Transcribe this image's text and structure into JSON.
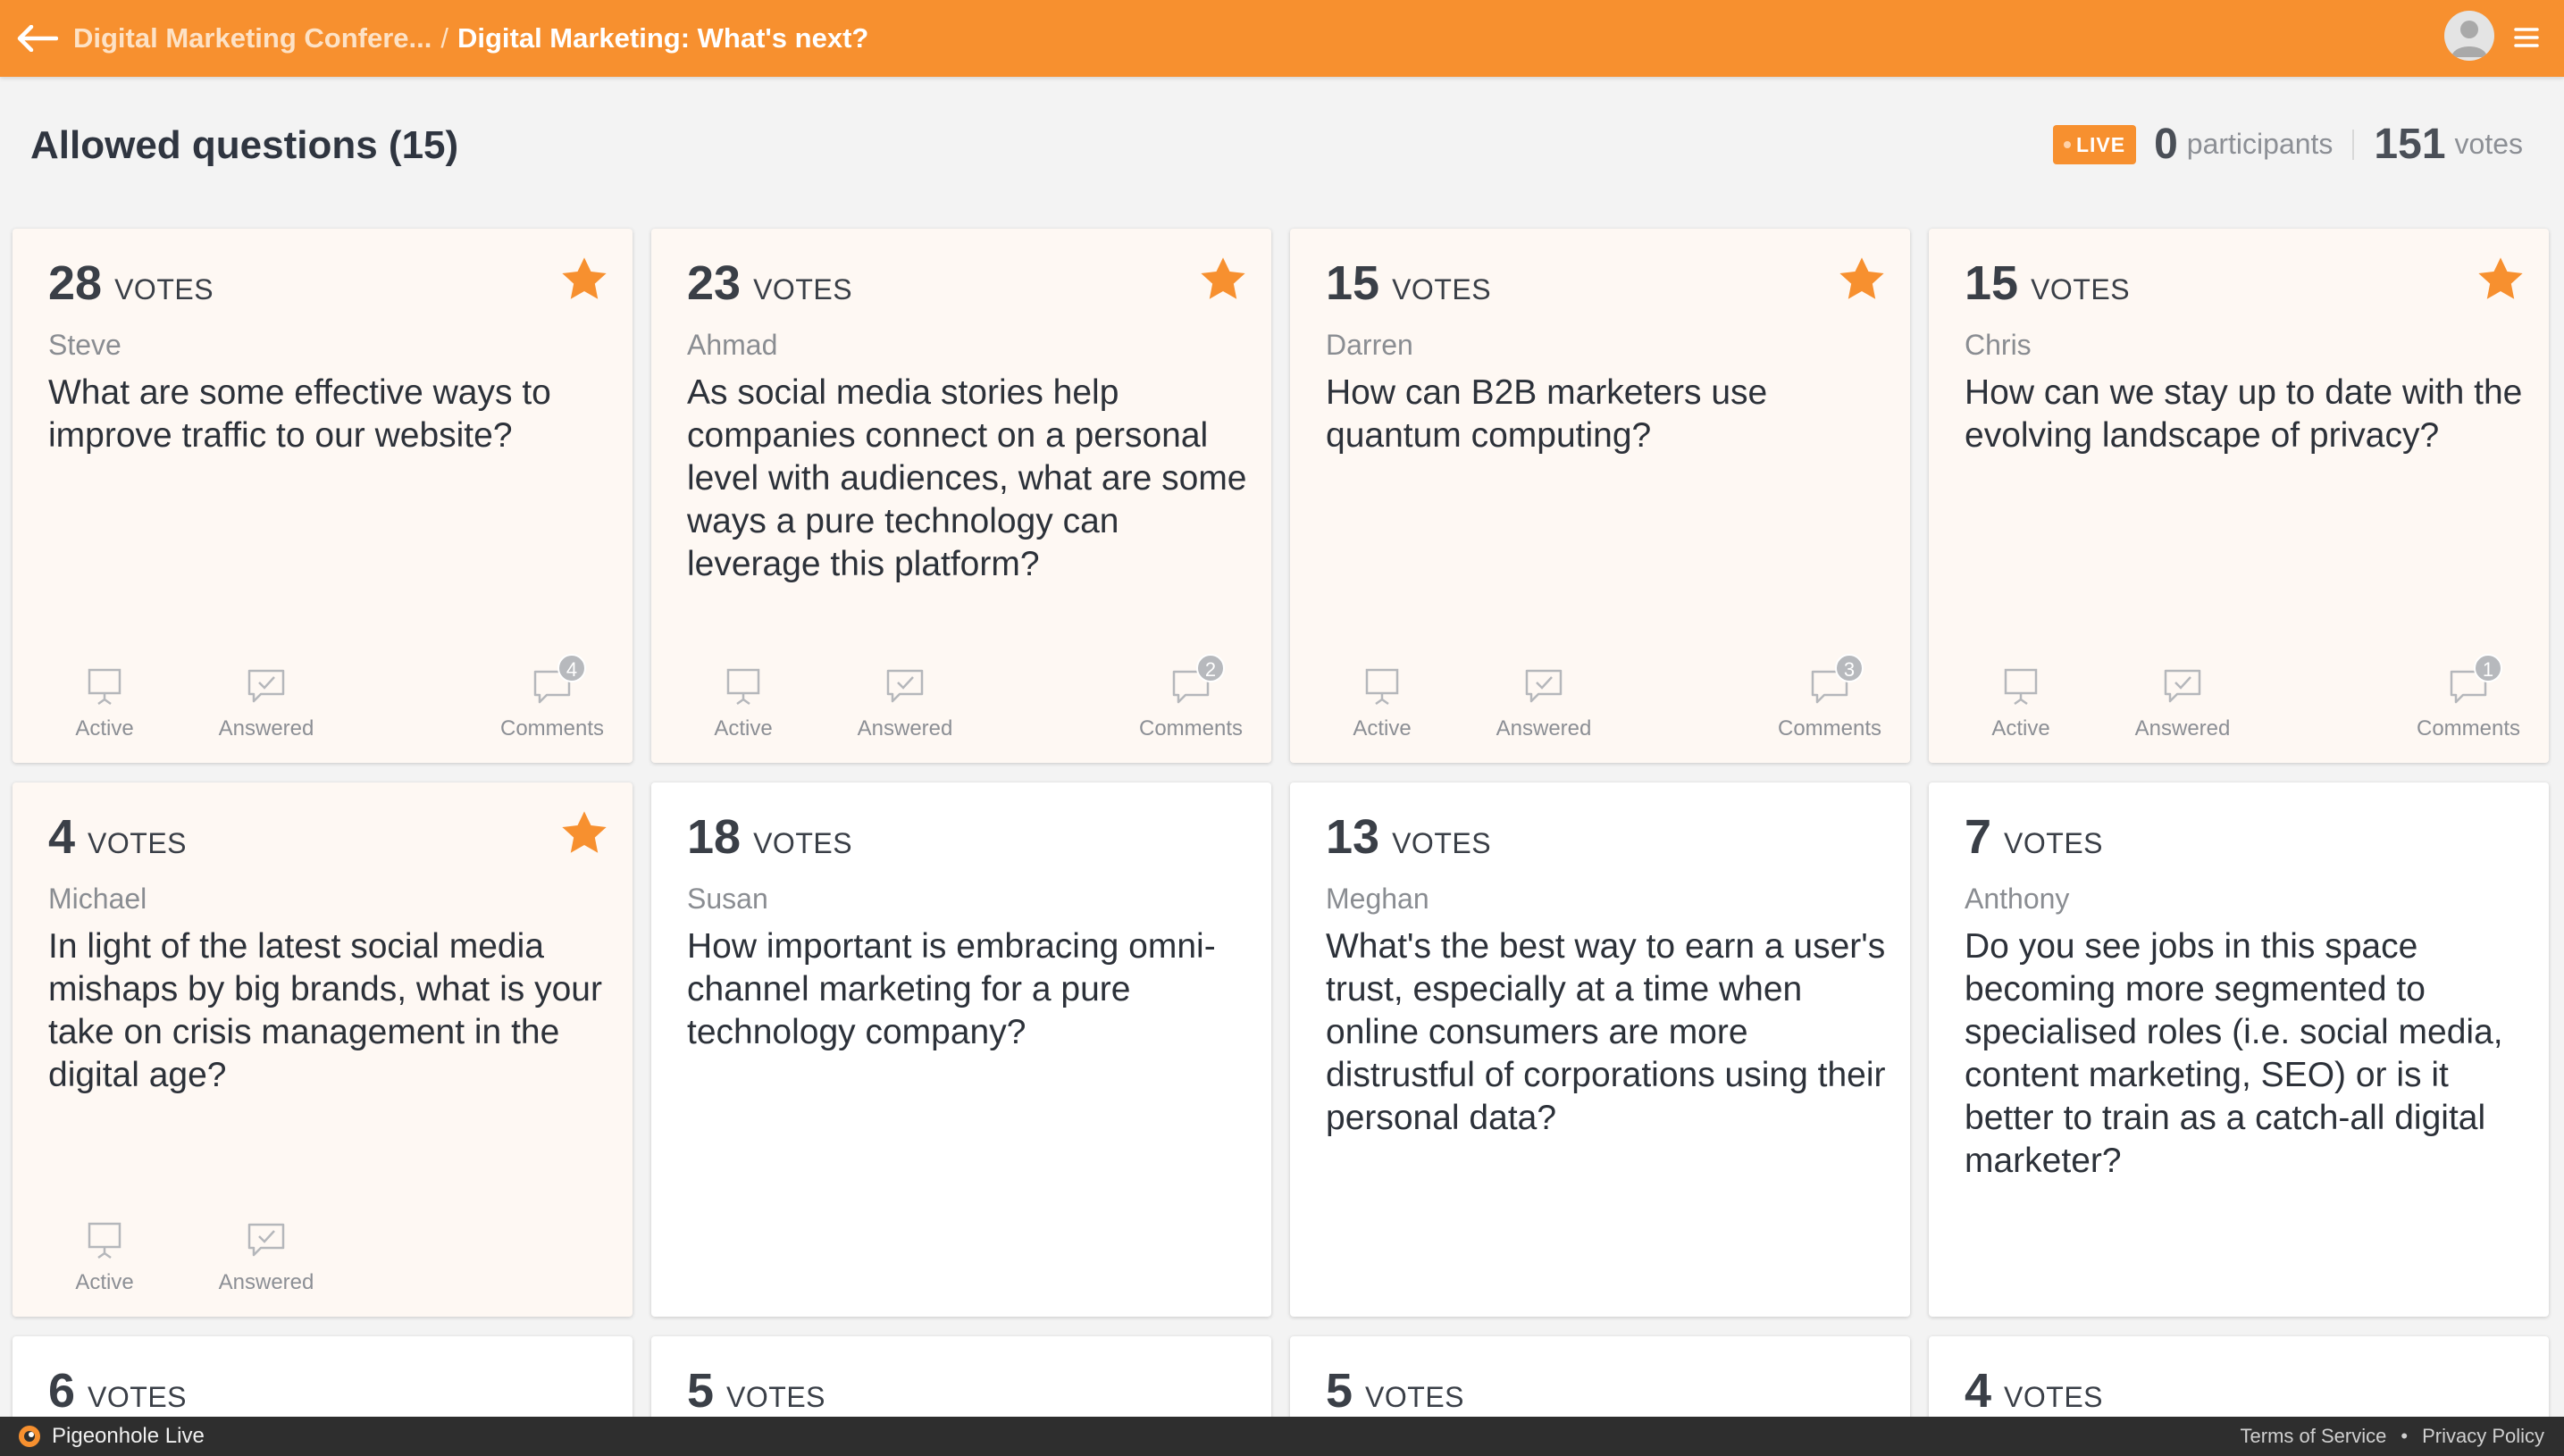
{
  "header": {
    "breadcrumb_parent": "Digital Marketing Confere...",
    "separator": "/",
    "breadcrumb_current": "Digital Marketing: What's next?",
    "accent": "#f7902f"
  },
  "page": {
    "title": "Allowed questions (15)",
    "live_label": "LIVE",
    "participants_count": "0",
    "participants_label": "participants",
    "votes_count": "151",
    "votes_label": "votes"
  },
  "labels": {
    "votes": "VOTES",
    "active": "Active",
    "answered": "Answered",
    "comments": "Comments"
  },
  "questions": [
    {
      "votes": "28",
      "author": "Steve",
      "text": "What are some effective ways to improve traffic to our website?",
      "starred": true,
      "comments": "4"
    },
    {
      "votes": "23",
      "author": "Ahmad",
      "text": "As social media stories help companies connect on a personal level with audiences, what are some ways a pure technology can leverage this platform?",
      "starred": true,
      "comments": "2"
    },
    {
      "votes": "15",
      "author": "Darren",
      "text": "How can B2B marketers use quantum computing?",
      "starred": true,
      "comments": "3"
    },
    {
      "votes": "15",
      "author": "Chris",
      "text": "How can we stay up to date with the evolving landscape of privacy?",
      "starred": true,
      "comments": "1"
    },
    {
      "votes": "4",
      "author": "Michael",
      "text": "In light of the latest social media mishaps by big brands, what is your take on crisis management in the digital age?",
      "starred": true,
      "comments": ""
    },
    {
      "votes": "18",
      "author": "Susan",
      "text": "How important is embracing omni-channel marketing for a pure technology company?",
      "starred": false
    },
    {
      "votes": "13",
      "author": "Meghan",
      "text": "What's the best way to earn a user's trust, especially at a time when online consumers are more distrustful of corporations using their personal data?",
      "starred": false
    },
    {
      "votes": "7",
      "author": "Anthony",
      "text": "Do you see jobs in this space becoming more segmented to specialised roles (i.e. social media, content marketing, SEO) or is it better to train as a catch-all digital marketer?",
      "starred": false
    },
    {
      "votes": "6"
    },
    {
      "votes": "5"
    },
    {
      "votes": "5"
    },
    {
      "votes": "4"
    }
  ],
  "footer": {
    "brand": "Pigeonhole Live",
    "terms": "Terms of Service",
    "dot": "•",
    "privacy": "Privacy Policy"
  }
}
